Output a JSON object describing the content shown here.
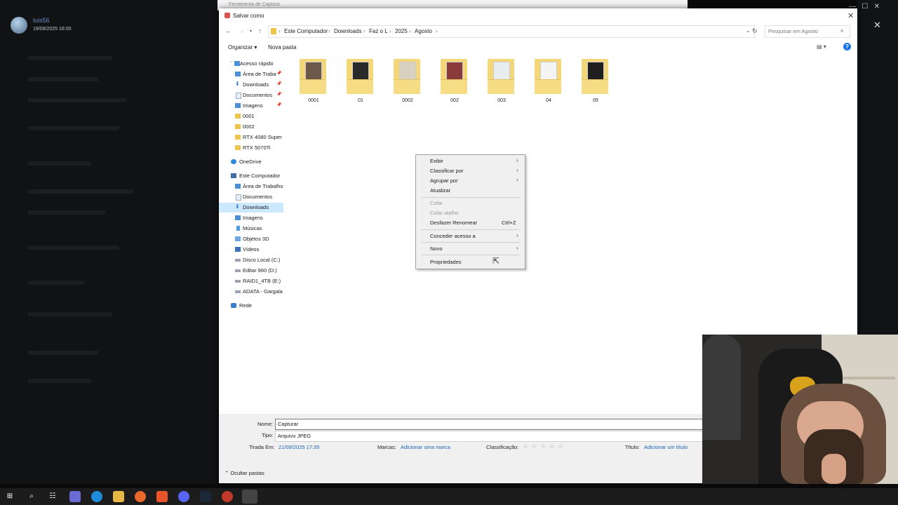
{
  "background": {
    "user_name": "luis56",
    "user_timestamp": "19/09/2025 16:00"
  },
  "capture_tool": {
    "title": "Ferramenta de Captura"
  },
  "dialog": {
    "title": "Salvar como",
    "close_icon": "close-icon",
    "breadcrumb": [
      "Este Computador",
      "Downloads",
      "Faz o L",
      "2025",
      "Agosto"
    ],
    "search_placeholder": "Pesquisar em Agosto",
    "toolbar": {
      "organize": "Organizar ▾",
      "new_folder": "Nova pasta"
    },
    "nav_pane": {
      "quick_access": "Acesso rápido",
      "quick_items": [
        {
          "label": "Área de Traba",
          "pinned": true
        },
        {
          "label": "Downloads",
          "pinned": true
        },
        {
          "label": "Documentos",
          "pinned": true
        },
        {
          "label": "Imagens",
          "pinned": true
        },
        {
          "label": "0001",
          "pinned": false
        },
        {
          "label": "0002",
          "pinned": false
        },
        {
          "label": "RTX 4080 Super",
          "pinned": false
        },
        {
          "label": "RTX 5070Ti",
          "pinned": false
        }
      ],
      "onedrive": "OneDrive",
      "this_pc": "Este Computador",
      "pc_items": [
        "Área de Trabalho",
        "Documentos",
        "Downloads",
        "Imagens",
        "Músicas",
        "Objetos 3D",
        "Vídeos",
        "Disco Local (C:)",
        "Editar 960 (D:)",
        "RAID1_4TB (E:)",
        "ADATA - Gargala"
      ],
      "selected": "Downloads",
      "network": "Rede"
    },
    "files": [
      "0001",
      "01",
      "0002",
      "002",
      "003",
      "04",
      "05"
    ],
    "fields": {
      "name_label": "Nome:",
      "name_value": "Capturar",
      "type_label": "Tipo:",
      "type_value": "Arquivo JPEG",
      "taken_label": "Tirada Em:",
      "taken_value": "21/09/2025 17:35",
      "tags_label": "Marcas:",
      "tags_value": "Adicionar uma marca",
      "rating_label": "Classificação:",
      "rating_stars": "☆ ☆ ☆ ☆ ☆",
      "title_label": "Título:",
      "title_value": "Adicionar um título"
    },
    "hide_folders": "Ocultar pastas"
  },
  "context_menu": {
    "items": [
      {
        "label": "Exibir",
        "submenu": true
      },
      {
        "label": "Classificar por",
        "submenu": true
      },
      {
        "label": "Agrupar por",
        "submenu": true
      },
      {
        "label": "Atualizar"
      },
      {
        "label": "Colar",
        "disabled": true
      },
      {
        "label": "Colar atalho",
        "disabled": true
      },
      {
        "label": "Desfazer Renomear",
        "shortcut": "Ctrl+Z"
      },
      {
        "label": "Conceder acesso a",
        "submenu": true
      },
      {
        "label": "Novo",
        "submenu": true
      },
      {
        "label": "Propriedades"
      }
    ]
  }
}
